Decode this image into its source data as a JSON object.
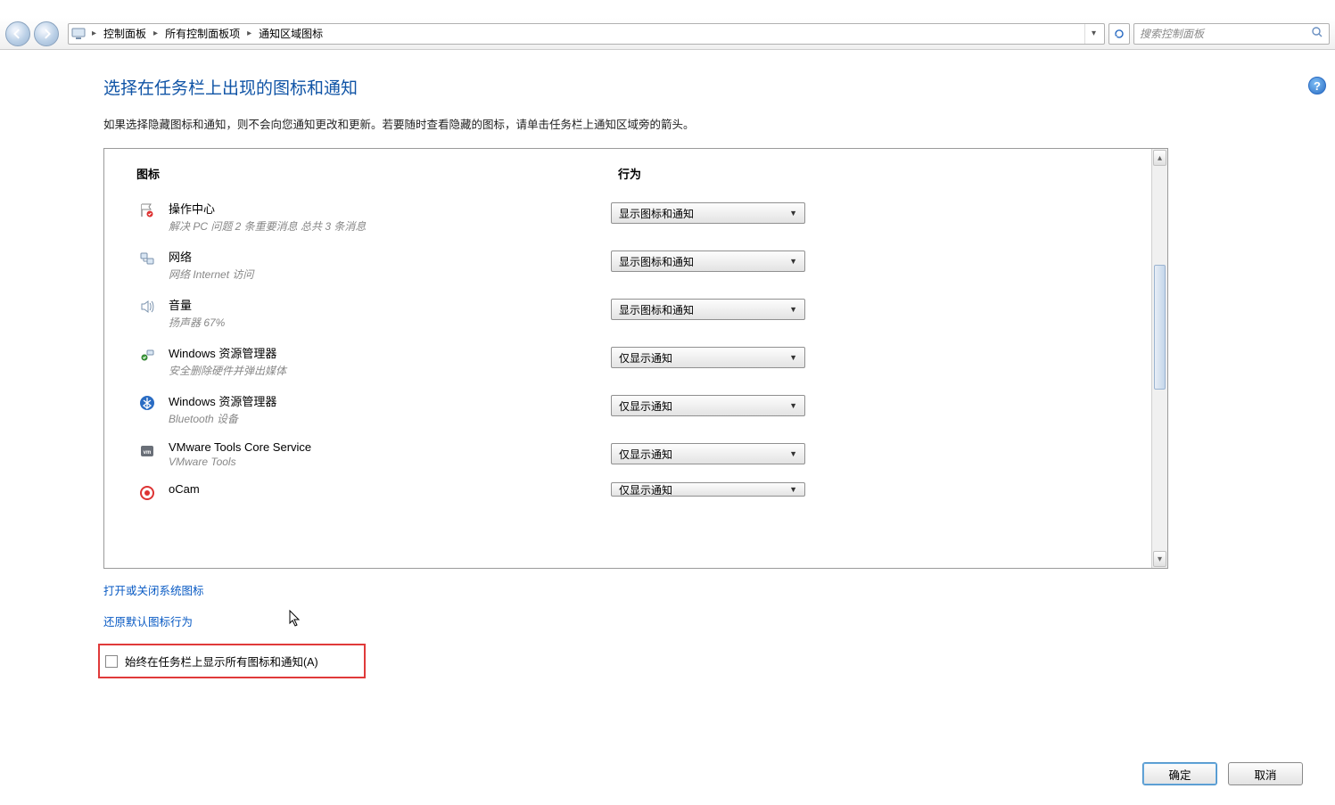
{
  "breadcrumb": {
    "parts": [
      "控制面板",
      "所有控制面板项",
      "通知区域图标"
    ]
  },
  "search": {
    "placeholder": "搜索控制面板"
  },
  "header": {
    "title": "选择在任务栏上出现的图标和通知",
    "desc": "如果选择隐藏图标和通知，则不会向您通知更改和更新。若要随时查看隐藏的图标，请单击任务栏上通知区域旁的箭头。"
  },
  "columns": {
    "icon": "图标",
    "behavior": "行为"
  },
  "options": {
    "show_icon_and_notif": "显示图标和通知",
    "notif_only": "仅显示通知"
  },
  "rows": [
    {
      "title": "操作中心",
      "sub": "解决 PC 问题  2 条重要消息 总共 3 条消息",
      "value": "显示图标和通知",
      "icon": "action-center"
    },
    {
      "title": "网络",
      "sub": "网络 Internet 访问",
      "value": "显示图标和通知",
      "icon": "network"
    },
    {
      "title": "音量",
      "sub": "扬声器 67%",
      "value": "显示图标和通知",
      "icon": "volume"
    },
    {
      "title": "Windows 资源管理器",
      "sub": "安全删除硬件并弹出媒体",
      "value": "仅显示通知",
      "icon": "eject"
    },
    {
      "title": "Windows 资源管理器",
      "sub": "Bluetooth 设备",
      "value": "仅显示通知",
      "icon": "bluetooth"
    },
    {
      "title": "VMware Tools Core Service",
      "sub": "VMware Tools",
      "value": "仅显示通知",
      "icon": "vmware"
    },
    {
      "title": "oCam",
      "sub": "",
      "value": "仅显示通知",
      "icon": "ocam"
    }
  ],
  "links": {
    "system_icons": "打开或关闭系统图标",
    "restore": "还原默认图标行为"
  },
  "always": {
    "label": "始终在任务栏上显示所有图标和通知(A)"
  },
  "buttons": {
    "ok": "确定",
    "cancel": "取消"
  }
}
